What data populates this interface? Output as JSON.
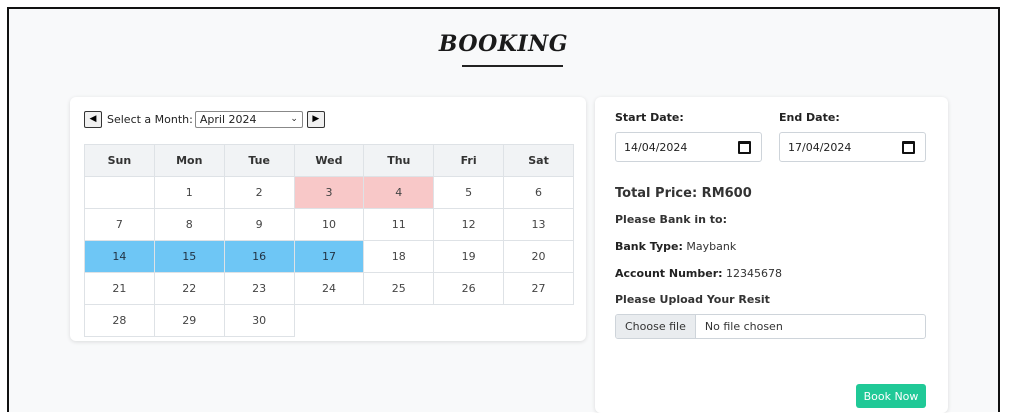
{
  "page": {
    "title": "BOOKING"
  },
  "calendar": {
    "month_label": "Select a Month:",
    "selected_month": "April 2024",
    "prev_icon": "◀",
    "next_icon": "▶",
    "weekdays": [
      "Sun",
      "Mon",
      "Tue",
      "Wed",
      "Thu",
      "Fri",
      "Sat"
    ],
    "weeks": [
      [
        "",
        "1",
        "2",
        "3",
        "4",
        "5",
        "6"
      ],
      [
        "7",
        "8",
        "9",
        "10",
        "11",
        "12",
        "13"
      ],
      [
        "14",
        "15",
        "16",
        "17",
        "18",
        "19",
        "20"
      ],
      [
        "21",
        "22",
        "23",
        "24",
        "25",
        "26",
        "27"
      ],
      [
        "28",
        "29",
        "30",
        "",
        "",
        "",
        ""
      ]
    ],
    "booked_days": [
      "3",
      "4"
    ],
    "selected_days": [
      "14",
      "15",
      "16",
      "17"
    ],
    "colors": {
      "booked": "#f8c8c8",
      "selected": "#6ec6f5"
    }
  },
  "form": {
    "start_label": "Start Date:",
    "start_value": "14/04/2024",
    "end_label": "End Date:",
    "end_value": "17/04/2024",
    "total_price": "Total Price: RM600",
    "bank_in_label": "Please Bank in to:",
    "bank_type_label": "Bank Type:",
    "bank_type_value": "Maybank",
    "account_label": "Account Number:",
    "account_value": "12345678",
    "upload_label": "Please Upload Your Resit",
    "file_button": "Choose file",
    "file_status": "No file chosen",
    "submit_label": "Book Now",
    "submit_color": "#20c997"
  }
}
